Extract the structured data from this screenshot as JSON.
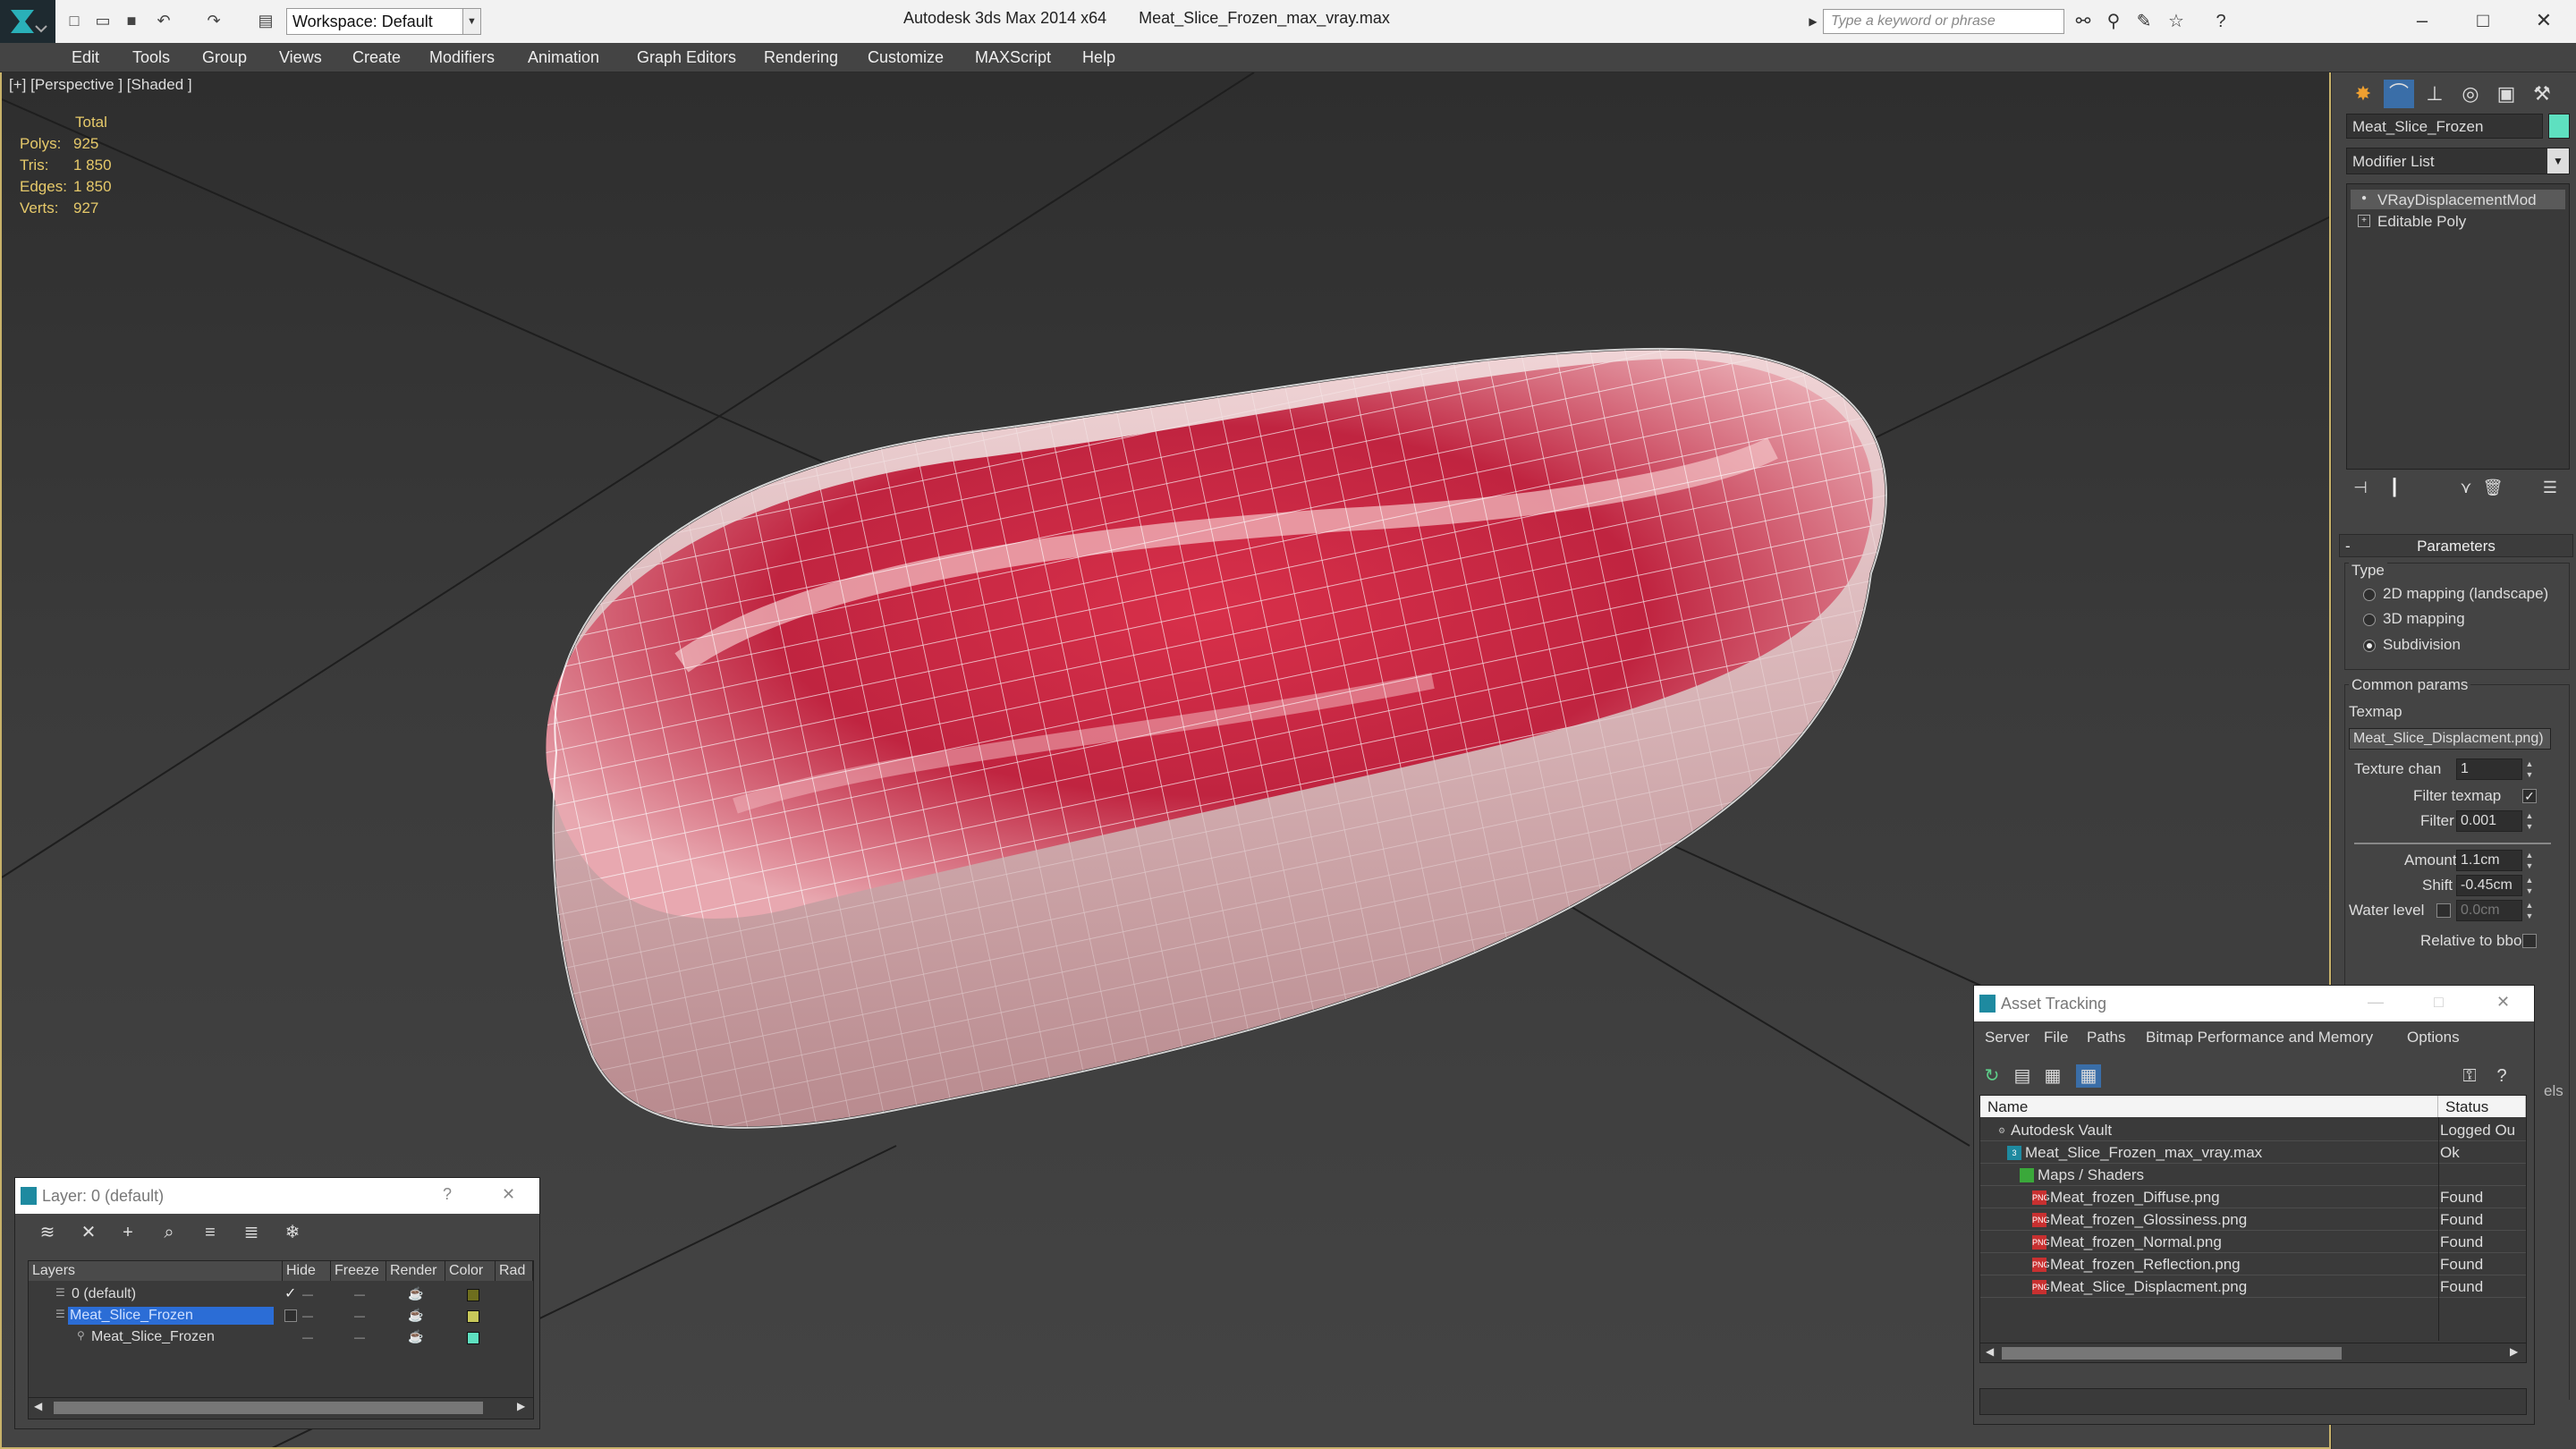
{
  "window": {
    "app_title": "Autodesk 3ds Max  2014 x64",
    "file_title": "Meat_Slice_Frozen_max_vray.max",
    "workspace": "Workspace: Default",
    "search_placeholder": "Type a keyword or phrase"
  },
  "menu": [
    "Edit",
    "Tools",
    "Group",
    "Views",
    "Create",
    "Modifiers",
    "Animation",
    "Graph Editors",
    "Rendering",
    "Customize",
    "MAXScript",
    "Help"
  ],
  "viewport": {
    "label": "[+] [Perspective ] [Shaded ]",
    "stats_header": "Total",
    "stats": [
      {
        "k": "Polys:",
        "v": "925"
      },
      {
        "k": "Tris:",
        "v": "1 850"
      },
      {
        "k": "Edges:",
        "v": "1 850"
      },
      {
        "k": "Verts:",
        "v": "927"
      }
    ]
  },
  "command_panel": {
    "object_name": "Meat_Slice_Frozen",
    "object_color": "#5ee0c0",
    "modifier_list": "Modifier List",
    "stack": [
      "VRayDisplacementMod",
      "Editable Poly"
    ],
    "rollout": "Parameters",
    "type_label": "Type",
    "type_options": [
      "2D mapping (landscape)",
      "3D mapping",
      "Subdivision"
    ],
    "selected_type": "Subdivision",
    "common_params": "Common params",
    "texmap_label": "Texmap",
    "texmap_value": "Meat_Slice_Displacment.png)",
    "texture_chan_label": "Texture chan",
    "texture_chan_value": "1",
    "filter_texmap_label": "Filter texmap",
    "filter_blur_label": "Filter blur",
    "filter_blur_value": "0.001",
    "amount_label": "Amount",
    "amount_value": "1.1cm",
    "shift_label": "Shift",
    "shift_value": "-0.45cm",
    "water_level_label": "Water level",
    "water_level_value": "0.0cm",
    "relative_bbox_label": "Relative to bbox",
    "side_label": "els"
  },
  "layer_window": {
    "title": "Layer: 0 (default)",
    "help": "?",
    "columns": [
      "Layers",
      "Hide",
      "Freeze",
      "Render",
      "Color",
      "Rad"
    ],
    "rows": [
      {
        "name": "0 (default)",
        "color": "#6e6e1e"
      },
      {
        "name": "Meat_Slice_Frozen",
        "color": "#c8c85a"
      },
      {
        "name": "Meat_Slice_Frozen",
        "color": "#5ee0c0"
      }
    ]
  },
  "asset_tracking": {
    "title": "Asset Tracking",
    "menu": [
      "Server",
      "File",
      "Paths",
      "Bitmap Performance and Memory",
      "Options"
    ],
    "columns": [
      "Name",
      "Status"
    ],
    "rows": [
      {
        "name": "Autodesk Vault",
        "status": "Logged Ou"
      },
      {
        "name": "Meat_Slice_Frozen_max_vray.max",
        "status": "Ok"
      },
      {
        "name": "Maps / Shaders",
        "status": ""
      },
      {
        "name": "Meat_frozen_Diffuse.png",
        "status": "Found"
      },
      {
        "name": "Meat_frozen_Glossiness.png",
        "status": "Found"
      },
      {
        "name": "Meat_frozen_Normal.png",
        "status": "Found"
      },
      {
        "name": "Meat_frozen_Reflection.png",
        "status": "Found"
      },
      {
        "name": "Meat_Slice_Displacment.png",
        "status": "Found"
      }
    ]
  }
}
